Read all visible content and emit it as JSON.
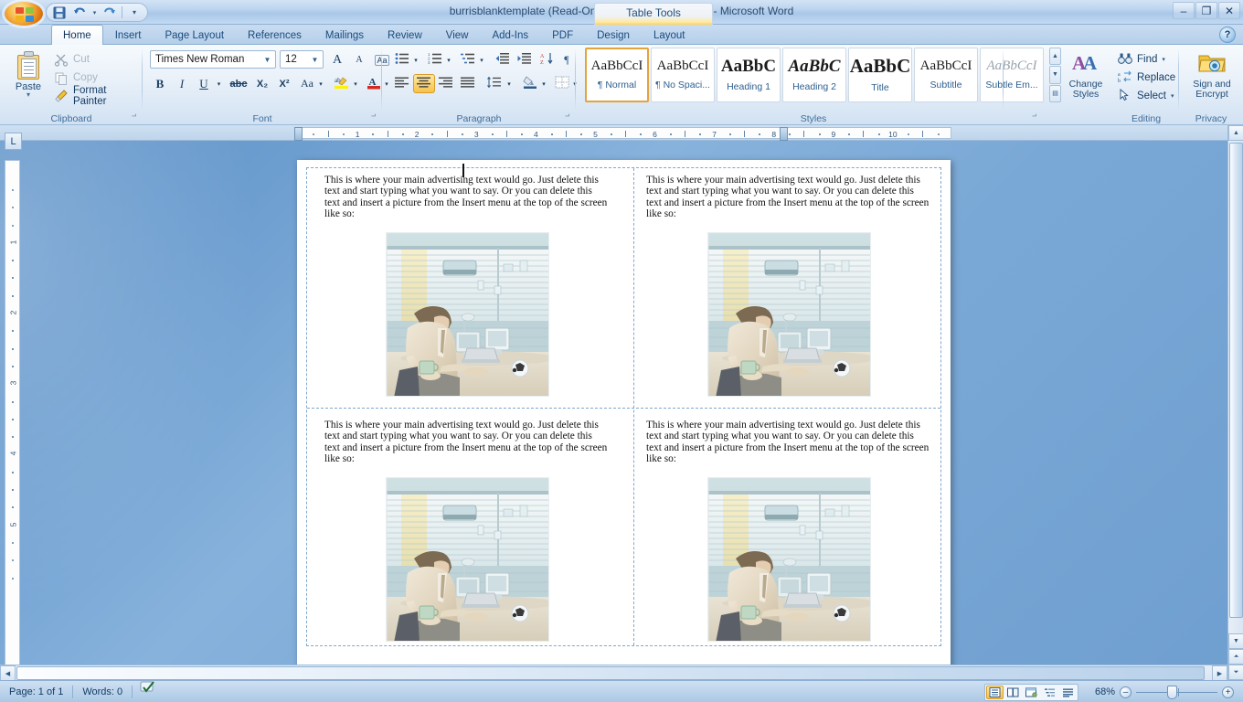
{
  "window": {
    "title": "burrisblanktemplate (Read-Only) [Compatibility Mode] - Microsoft Word",
    "contextual_tab": "Table Tools",
    "minimize": "–",
    "restore": "❐",
    "close": "✕"
  },
  "quick_access": {
    "save": "save-icon",
    "undo": "undo-icon",
    "redo": "redo-icon",
    "customize": "▾"
  },
  "tabs": [
    {
      "label": "Home",
      "active": true
    },
    {
      "label": "Insert",
      "active": false
    },
    {
      "label": "Page Layout",
      "active": false
    },
    {
      "label": "References",
      "active": false
    },
    {
      "label": "Mailings",
      "active": false
    },
    {
      "label": "Review",
      "active": false
    },
    {
      "label": "View",
      "active": false
    },
    {
      "label": "Add-Ins",
      "active": false
    },
    {
      "label": "PDF",
      "active": false
    },
    {
      "label": "Design",
      "active": false
    },
    {
      "label": "Layout",
      "active": false
    }
  ],
  "help_button": "?",
  "ribbon": {
    "clipboard": {
      "group_label": "Clipboard",
      "paste": "Paste",
      "paste_caret": "▾",
      "cut": "Cut",
      "copy": "Copy",
      "format_painter": "Format Painter"
    },
    "font": {
      "group_label": "Font",
      "font_name": "Times New Roman",
      "font_size": "12",
      "grow_font": "A",
      "shrink_font": "A",
      "clear_formatting": "Aa",
      "bold": "B",
      "italic": "I",
      "underline": "U",
      "strikethrough": "abc",
      "subscript": "X₂",
      "superscript": "X²",
      "change_case": "Aa",
      "highlight": "ab",
      "font_color": "A"
    },
    "paragraph": {
      "group_label": "Paragraph",
      "bullets": "bullets-icon",
      "numbering": "numbering-icon",
      "multilevel": "multilevel-list-icon",
      "decrease_indent": "decrease-indent-icon",
      "increase_indent": "increase-indent-icon",
      "sort": "sort-icon",
      "show_marks": "¶",
      "align_left": "align-left-icon",
      "align_center": "align-center-icon",
      "align_right": "align-right-icon",
      "justify": "justify-icon",
      "line_spacing": "line-spacing-icon",
      "shading": "shading-icon",
      "borders": "borders-icon",
      "active_alignment": "align_center"
    },
    "styles": {
      "group_label": "Styles",
      "items": [
        {
          "preview": "AaBbCcI",
          "name": "¶ Normal",
          "selected": true
        },
        {
          "preview": "AaBbCcI",
          "name": "¶ No Spaci...",
          "selected": false
        },
        {
          "preview": "AaBbC",
          "name": "Heading 1",
          "selected": false
        },
        {
          "preview": "AaBbC",
          "name": "Heading 2",
          "selected": false
        },
        {
          "preview": "AaBbC",
          "name": "Title",
          "selected": false
        },
        {
          "preview": "AaBbCcI",
          "name": "Subtitle",
          "selected": false
        },
        {
          "preview": "AaBbCcI",
          "name": "Subtle Em...",
          "selected": false
        }
      ],
      "change_styles": "Change\nStyles",
      "change_styles_l1": "Change",
      "change_styles_l2": "Styles",
      "change_styles_caret": "▾"
    },
    "editing": {
      "group_label": "Editing",
      "find": "Find",
      "find_caret": "▾",
      "replace": "Replace",
      "select": "Select",
      "select_caret": "▾"
    },
    "privacy": {
      "group_label": "Privacy",
      "sign_and_encrypt_l1": "Sign and",
      "sign_and_encrypt_l2": "Encrypt",
      "caret": "▾"
    }
  },
  "rulers": {
    "horizontal_marks": [
      "1",
      "2",
      "3",
      "4",
      "5",
      "6",
      "7",
      "8",
      "9",
      "10"
    ],
    "vertical_marks": [
      "1",
      "2",
      "3",
      "4",
      "5"
    ],
    "tab_selector": "L"
  },
  "document": {
    "body_text": "This is where your main advertising text would go. Just delete this text and start typing what you want to say. Or you can delete this text and insert a picture from the Insert menu at the top of the screen like so:",
    "cells": [
      {
        "id": "top-left"
      },
      {
        "id": "top-right"
      },
      {
        "id": "bottom-left"
      },
      {
        "id": "bottom-right"
      }
    ],
    "image_alt": "businessman-at-desk-photo"
  },
  "status_bar": {
    "page": "Page: 1 of 1",
    "words": "Words: 0",
    "proofing": "proofing-errors-icon",
    "views": [
      {
        "name": "print-layout",
        "selected": true
      },
      {
        "name": "full-screen-reading",
        "selected": false
      },
      {
        "name": "web-layout",
        "selected": false
      },
      {
        "name": "outline",
        "selected": false
      },
      {
        "name": "draft",
        "selected": false
      }
    ],
    "zoom": "68%",
    "zoom_out": "–",
    "zoom_in": "+"
  },
  "colors": {
    "accent": "#e5a33a",
    "chrome": "#bdd5ef",
    "canvas": "#6f9fd0",
    "text": "#16436e"
  }
}
